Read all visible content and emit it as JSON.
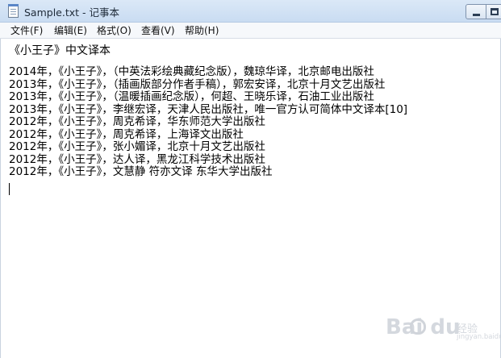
{
  "window": {
    "title": "Sample.txt - 记事本"
  },
  "menu": [
    {
      "label": "文件(F)"
    },
    {
      "label": "编辑(E)"
    },
    {
      "label": "格式(O)"
    },
    {
      "label": "查看(V)"
    },
    {
      "label": "帮助(H)"
    }
  ],
  "document": {
    "heading": "《小王子》中文译本",
    "lines": [
      "2014年，《小王子》，（中英法彩绘典藏纪念版），魏琼华译，北京邮电出版社",
      "2013年，《小王子》，（插画版部分作者手稿），郭宏安译，北京十月文艺出版社",
      "2013年，《小王子》，（温暖插画纪念版），何超、王晓乐译，石油工业出版社",
      "2013年，《小王子》，李继宏译，天津人民出版社，唯一官方认可简体中文译本[10]",
      "2012年，《小王子》，周克希译，华东师范大学出版社",
      "2012年，《小王子》，周克希译，上海译文出版社",
      "2012年，《小王子》，张小媚译，北京十月文艺出版社",
      "2012年，《小王子》，达人译，黑龙江科学技术出版社",
      "2012年，《小王子》，文慧静 符亦文译 东华大学出版社"
    ]
  },
  "watermark": {
    "brand": "Bai du",
    "sub": "经验",
    "url": "jingyan.baidu.com"
  },
  "colors": {
    "titlebar": "#c9dcf2",
    "menubar": "#f6f8fb",
    "text": "#000000",
    "watermark": "#d4d8de"
  }
}
